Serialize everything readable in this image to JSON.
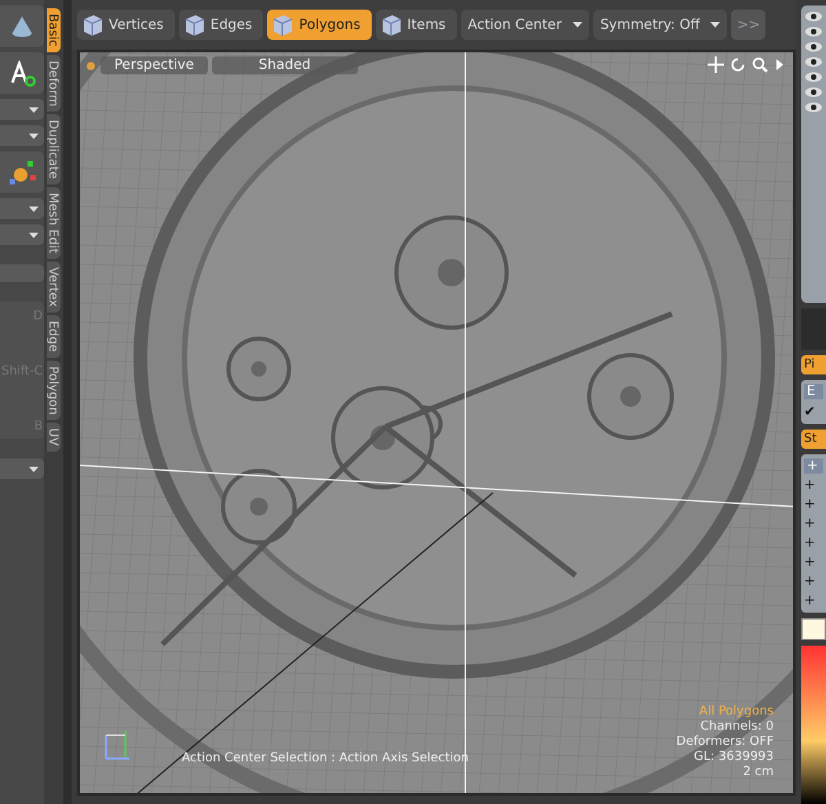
{
  "tool_column": {
    "shortcuts": [
      "D",
      "Shift-C",
      "B"
    ]
  },
  "vertical_tabs": [
    {
      "label": "Basic",
      "selected": true
    },
    {
      "label": "Deform",
      "selected": false
    },
    {
      "label": "Duplicate",
      "selected": false
    },
    {
      "label": "Mesh Edit",
      "selected": false
    },
    {
      "label": "Vertex",
      "selected": false
    },
    {
      "label": "Edge",
      "selected": false
    },
    {
      "label": "Polygon",
      "selected": false
    },
    {
      "label": "UV",
      "selected": false
    }
  ],
  "toolbar": {
    "modes": [
      {
        "label": "Vertices",
        "selected": false
      },
      {
        "label": "Edges",
        "selected": false
      },
      {
        "label": "Polygons",
        "selected": true
      },
      {
        "label": "Items",
        "selected": false
      }
    ],
    "dropdowns": [
      "Action Center",
      "Symmetry: Off"
    ],
    "more_button": ">>"
  },
  "viewport": {
    "view": "Perspective",
    "shading": "Shaded",
    "info": [
      {
        "text": "All Polygons",
        "highlighted": true
      },
      {
        "text": "Channels: 0",
        "highlighted": false
      },
      {
        "text": "Deformers: OFF",
        "highlighted": false
      },
      {
        "text": "GL: 3639993",
        "highlighted": false
      },
      {
        "text": "2 cm",
        "highlighted": false
      }
    ],
    "status_message": "Action Center Selection : Action Axis Selection"
  },
  "right_panel": {
    "pipeline_tab": "Pi",
    "column_label": "E",
    "check": "✔",
    "stack_tab": "St",
    "add_marks": [
      "+",
      "+",
      "+",
      "+",
      "+",
      "+",
      "+",
      "+"
    ]
  }
}
